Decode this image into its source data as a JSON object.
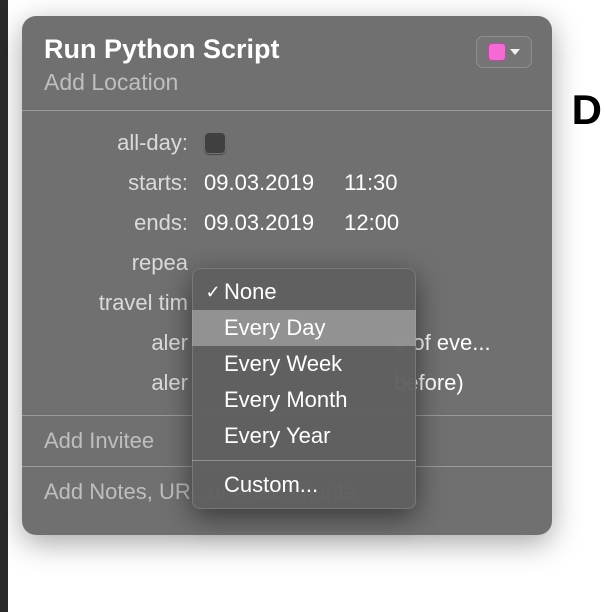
{
  "stray_char": "D",
  "event": {
    "title": "Run Python Script",
    "location_placeholder": "Add Location",
    "calendar_color": "#f569d5"
  },
  "rows": {
    "allday_label": "all-day:",
    "starts_label": "starts:",
    "starts_date": "09.03.2019",
    "starts_time": "11:30",
    "ends_label": "ends:",
    "ends_date": "09.03.2019",
    "ends_time": "12:00",
    "repeat_label": "repea",
    "travel_label": "travel tim",
    "alert1_label": "aler",
    "alert1_value": "e of eve...",
    "alert2_label": "aler",
    "alert2_value": " before)"
  },
  "invite_placeholder": "Add Invitee",
  "notes_placeholder": "Add Notes, URL or Attachments",
  "repeat_menu": {
    "selected_index": 0,
    "highlight_index": 1,
    "items": [
      "None",
      "Every Day",
      "Every Week",
      "Every Month",
      "Every Year"
    ],
    "custom": "Custom..."
  }
}
